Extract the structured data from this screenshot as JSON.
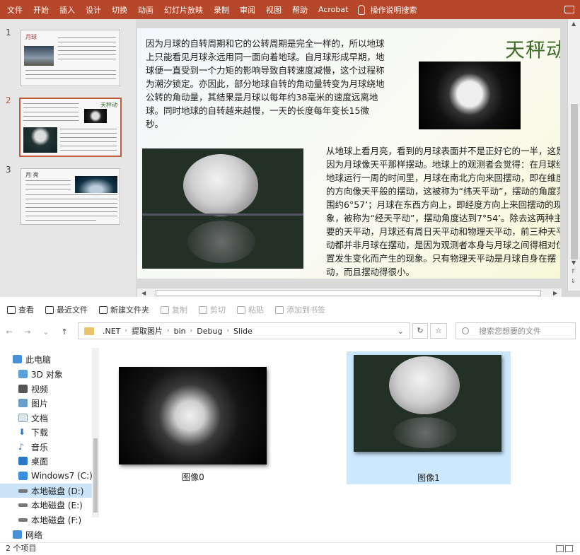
{
  "ribbon": {
    "tabs": [
      "文件",
      "开始",
      "插入",
      "设计",
      "切换",
      "动画",
      "幻灯片放映",
      "录制",
      "审阅",
      "视图",
      "帮助",
      "Acrobat"
    ],
    "tell_me": "操作说明搜索"
  },
  "thumbnails": [
    {
      "number": "1",
      "title": "月球"
    },
    {
      "number": "2",
      "title": "天秤动"
    },
    {
      "number": "3",
      "title": "月 亮"
    }
  ],
  "slide": {
    "title": "天秤动",
    "paragraph1": "因为月球的自转周期和它的公转周期是完全一样的，所以地球上只能看见月球永远用同一面向着地球。自月球形成早期，地球便一直受到一个力矩的影响导致自转速度减慢，这个过程称为潮汐锁定。亦因此，部分地球自转的角动量转变为月球绕地公转的角动量，其结果是月球以每年约38毫米的速度远离地球。同时地球的自转越来越慢，一天的长度每年变长15微秒。",
    "paragraph2": "从地球上看月亮，看到的月球表面并不是正好它的一半，这是因为月球像天平那样摆动。地球上的观测者会觉得：在月球绕地球运行一周的时间里，月球在南北方向来回摆动，即在维度的方向像天平般的摆动，这被称为“纬天平动”，摆动的角度范围约6°57’；月球在东西方向上，即经度方向上来回摆动的现象，被称为“经天平动”，摆动角度达到7°54’。除去这两种主要的天平动，月球还有周日天平动和物理天平动，前三种天平动都并非月球在摆动，是因为观测者本身与月球之间得相对位置发生变化而产生的现象。只有物理天平动是月球自身在摆动，而且摆动得很小。"
  },
  "toolbar": {
    "items": [
      {
        "label": "查看",
        "icon": "view-icon"
      },
      {
        "label": "最近文件",
        "icon": "recent-icon"
      },
      {
        "label": "新建文件夹",
        "icon": "new-folder-icon"
      },
      {
        "label": "复制",
        "icon": "copy-icon",
        "disabled": true
      },
      {
        "label": "剪切",
        "icon": "cut-icon",
        "disabled": true
      },
      {
        "label": "粘贴",
        "icon": "paste-icon",
        "disabled": true
      },
      {
        "label": "添加到书签",
        "icon": "bookmark-icon",
        "disabled": true
      }
    ]
  },
  "address": {
    "segments": [
      ".NET",
      "提取图片",
      "bin",
      "Debug",
      "Slide"
    ],
    "search_placeholder": "搜索您想要的文件"
  },
  "nav_pane": {
    "items": [
      "此电脑",
      "3D 对象",
      "视频",
      "图片",
      "文档",
      "下载",
      "音乐",
      "桌面",
      "Windows7 (C:)",
      "本地磁盘 (D:)",
      "本地磁盘 (E:)",
      "本地磁盘 (F:)",
      "网络"
    ],
    "selected": "本地磁盘 (D:)"
  },
  "files": [
    {
      "name": "图像0"
    },
    {
      "name": "图像1",
      "selected": true
    }
  ],
  "status": {
    "count": "2 个项目"
  }
}
